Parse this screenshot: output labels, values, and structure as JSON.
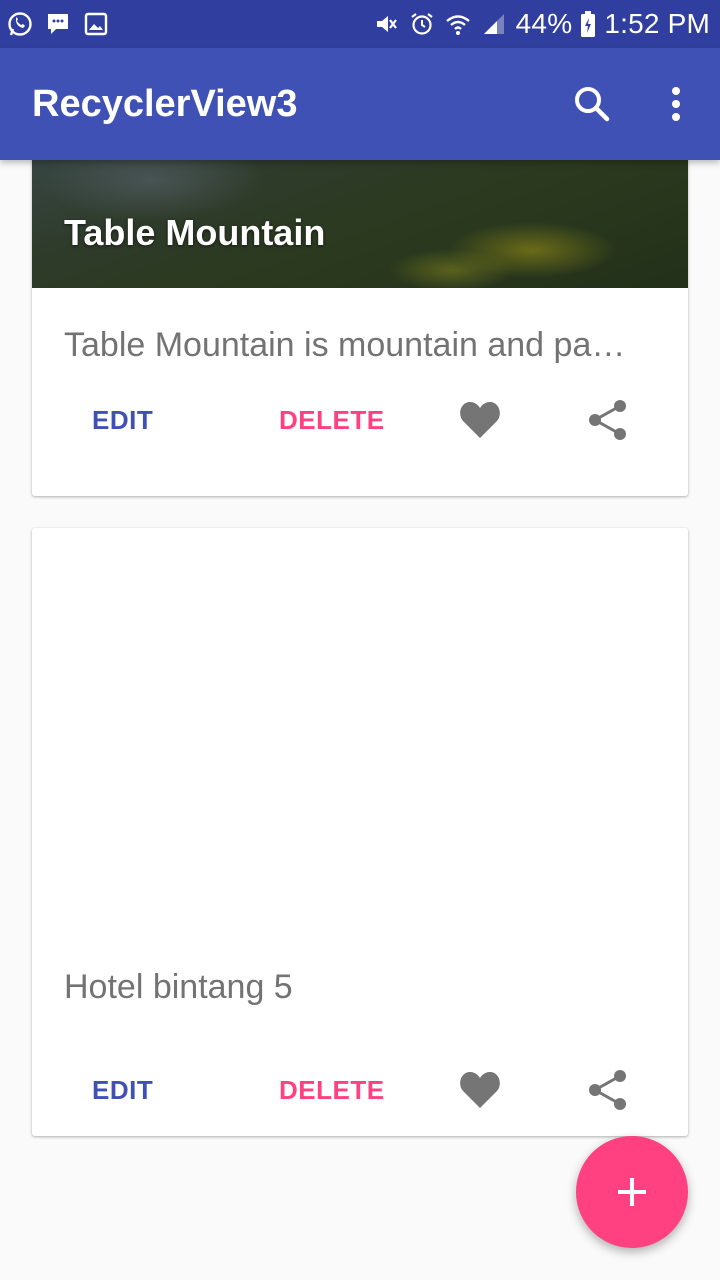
{
  "status_bar": {
    "battery": "44%",
    "time": "1:52 PM"
  },
  "app_bar": {
    "title": "RecyclerView3",
    "search_icon": "search-icon",
    "more_icon": "more-vert-icon"
  },
  "cards": [
    {
      "title": "Table Mountain",
      "description": "Table Mountain is mountain and pa…",
      "edit_label": "EDIT",
      "delete_label": "DELETE"
    },
    {
      "title": "",
      "description": "Hotel bintang 5",
      "edit_label": "EDIT",
      "delete_label": "DELETE"
    }
  ],
  "fab": {
    "icon": "add-icon"
  },
  "colors": {
    "primary": "#3f51b5",
    "primary_dark": "#303f9f",
    "accent": "#ff4081",
    "icon_gray": "#757575"
  }
}
